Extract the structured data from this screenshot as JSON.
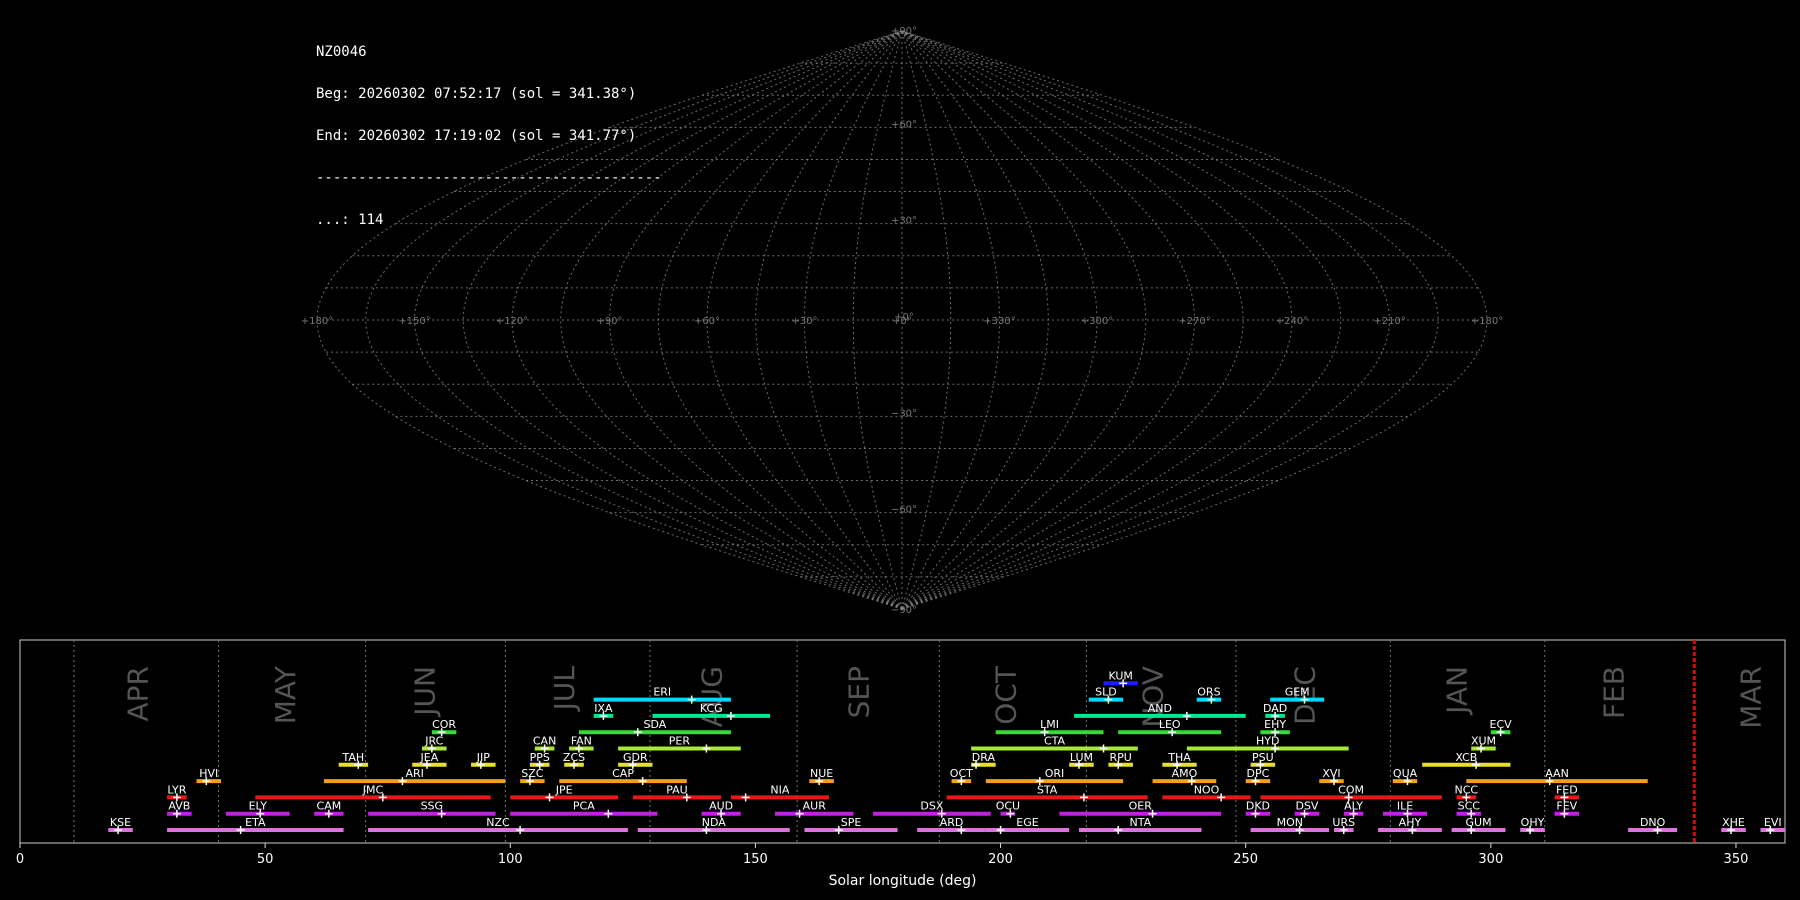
{
  "info": {
    "station": "NZ0046",
    "beg": "Beg: 20260302 07:52:17 (sol = 341.38°)",
    "end": "End: 20260302 17:19:02 (sol = 341.77°)",
    "separator": "-----------------------------------------",
    "count": "...: 114"
  },
  "sky_labels": {
    "lat": [
      "+90°",
      "+60°",
      "+30°",
      "+0°",
      "−30°",
      "−60°",
      "−90°"
    ],
    "lon": [
      "+180°",
      "+150°",
      "+120°",
      "+90°",
      "+60°",
      "+30°",
      "+0°",
      "+330°",
      "+300°",
      "+270°",
      "+240°",
      "+210°",
      "+180°"
    ]
  },
  "chart_data": {
    "type": "timeline",
    "title": "",
    "xlabel": "Solar longitude (deg)",
    "ylabel": "",
    "xlim": [
      0,
      360
    ],
    "xticks": [
      0,
      50,
      100,
      150,
      200,
      250,
      300,
      350
    ],
    "tick_labels": [
      "0",
      "50",
      "100",
      "150",
      "200",
      "250",
      "300",
      "350"
    ],
    "current_sol": 341.5,
    "months": [
      {
        "name": "APR",
        "sol": 11
      },
      {
        "name": "MAY",
        "sol": 40.5
      },
      {
        "name": "JUN",
        "sol": 70.5
      },
      {
        "name": "JUL",
        "sol": 99
      },
      {
        "name": "AUG",
        "sol": 128.5
      },
      {
        "name": "SEP",
        "sol": 158.5
      },
      {
        "name": "OCT",
        "sol": 187.5
      },
      {
        "name": "NOV",
        "sol": 217.5
      },
      {
        "name": "DEC",
        "sol": 248
      },
      {
        "name": "JAN",
        "sol": 279.5
      },
      {
        "name": "FEB",
        "sol": 311
      }
    ],
    "month_labels": [
      {
        "name": "APR",
        "sol": 24
      },
      {
        "name": "MAY",
        "sol": 54
      },
      {
        "name": "JUN",
        "sol": 82.5
      },
      {
        "name": "JUL",
        "sol": 111
      },
      {
        "name": "AUG",
        "sol": 141
      },
      {
        "name": "SEP",
        "sol": 171
      },
      {
        "name": "OCT",
        "sol": 201
      },
      {
        "name": "NOV",
        "sol": 231
      },
      {
        "name": "DEC",
        "sol": 262
      },
      {
        "name": "JAN",
        "sol": 293
      },
      {
        "name": "FEB",
        "sol": 325
      },
      {
        "name": "MAR",
        "sol": 353
      }
    ],
    "showers": [
      {
        "code": "KUM",
        "start": 221,
        "end": 228,
        "peak": 225,
        "row": 9,
        "color": "#1c1cff"
      },
      {
        "code": "ERI",
        "start": 117,
        "end": 145,
        "peak": 137,
        "row": 8,
        "color": "#00d8ff"
      },
      {
        "code": "SLD",
        "start": 218,
        "end": 225,
        "peak": 222,
        "row": 8,
        "color": "#00d8ff"
      },
      {
        "code": "ORS",
        "start": 240,
        "end": 245,
        "peak": 243,
        "row": 8,
        "color": "#00d8ff"
      },
      {
        "code": "GEM",
        "start": 255,
        "end": 266,
        "peak": 262,
        "row": 8,
        "color": "#00d8ff"
      },
      {
        "code": "IXA",
        "start": 117,
        "end": 121,
        "peak": 119,
        "row": 7,
        "color": "#00e890"
      },
      {
        "code": "KCG",
        "start": 129,
        "end": 153,
        "peak": 145,
        "row": 7,
        "color": "#00e890"
      },
      {
        "code": "AND",
        "start": 215,
        "end": 250,
        "peak": 238,
        "row": 7,
        "color": "#00e890"
      },
      {
        "code": "DAD",
        "start": 254,
        "end": 258,
        "peak": 256,
        "row": 7,
        "color": "#00e890"
      },
      {
        "code": "COR",
        "start": 84,
        "end": 89,
        "peak": 86,
        "row": 6,
        "color": "#38d838"
      },
      {
        "code": "SDA",
        "start": 114,
        "end": 145,
        "peak": 126,
        "row": 6,
        "color": "#38d838"
      },
      {
        "code": "LMI",
        "start": 199,
        "end": 221,
        "peak": 209,
        "row": 6,
        "color": "#38d838"
      },
      {
        "code": "LEO",
        "start": 224,
        "end": 245,
        "peak": 235,
        "row": 6,
        "color": "#38d838"
      },
      {
        "code": "EHY",
        "start": 253,
        "end": 259,
        "peak": 256,
        "row": 6,
        "color": "#38d838"
      },
      {
        "code": "ECV",
        "start": 300,
        "end": 304,
        "peak": 302,
        "row": 6,
        "color": "#38d838"
      },
      {
        "code": "JRC",
        "start": 82,
        "end": 87,
        "peak": 84,
        "row": 5,
        "color": "#a8e838"
      },
      {
        "code": "CAN",
        "start": 105,
        "end": 109,
        "peak": 107,
        "row": 5,
        "color": "#a8e838"
      },
      {
        "code": "FAN",
        "start": 112,
        "end": 117,
        "peak": 114,
        "row": 5,
        "color": "#a8e838"
      },
      {
        "code": "PER",
        "start": 122,
        "end": 147,
        "peak": 140,
        "row": 5,
        "color": "#a8e838"
      },
      {
        "code": "CTA",
        "start": 194,
        "end": 228,
        "peak": 221,
        "row": 5,
        "color": "#a8e838"
      },
      {
        "code": "HYD",
        "start": 238,
        "end": 271,
        "peak": 256,
        "row": 5,
        "color": "#a8e838"
      },
      {
        "code": "XUM",
        "start": 296,
        "end": 301,
        "peak": 298,
        "row": 5,
        "color": "#a8e838"
      },
      {
        "code": "TAH",
        "start": 65,
        "end": 71,
        "peak": 69,
        "row": 4,
        "color": "#e8e030"
      },
      {
        "code": "JEA",
        "start": 80,
        "end": 87,
        "peak": 83,
        "row": 4,
        "color": "#e8e030"
      },
      {
        "code": "JIP",
        "start": 92,
        "end": 97,
        "peak": 94,
        "row": 4,
        "color": "#e8e030"
      },
      {
        "code": "PPS",
        "start": 104,
        "end": 108,
        "peak": 106,
        "row": 4,
        "color": "#e8e030"
      },
      {
        "code": "ZCS",
        "start": 111,
        "end": 115,
        "peak": 113,
        "row": 4,
        "color": "#e8e030"
      },
      {
        "code": "GDR",
        "start": 122,
        "end": 129,
        "peak": 125,
        "row": 4,
        "color": "#e8e030"
      },
      {
        "code": "DRA",
        "start": 194,
        "end": 199,
        "peak": 195,
        "row": 4,
        "color": "#e8e030"
      },
      {
        "code": "LUM",
        "start": 214,
        "end": 219,
        "peak": 216,
        "row": 4,
        "color": "#e8e030"
      },
      {
        "code": "RPU",
        "start": 222,
        "end": 227,
        "peak": 224,
        "row": 4,
        "color": "#e8e030"
      },
      {
        "code": "THA",
        "start": 233,
        "end": 240,
        "peak": 236,
        "row": 4,
        "color": "#e8e030"
      },
      {
        "code": "PSU",
        "start": 251,
        "end": 256,
        "peak": 253,
        "row": 4,
        "color": "#e8e030"
      },
      {
        "code": "XCB",
        "start": 286,
        "end": 304,
        "peak": 297,
        "row": 4,
        "color": "#e8e030"
      },
      {
        "code": "HVI",
        "start": 36,
        "end": 41,
        "peak": 38,
        "row": 3,
        "color": "#f0a020"
      },
      {
        "code": "ARI",
        "start": 62,
        "end": 99,
        "peak": 78,
        "row": 3,
        "color": "#f0a020"
      },
      {
        "code": "SZC",
        "start": 102,
        "end": 107,
        "peak": 104,
        "row": 3,
        "color": "#f0a020"
      },
      {
        "code": "CAP",
        "start": 110,
        "end": 136,
        "peak": 127,
        "row": 3,
        "color": "#f0a020"
      },
      {
        "code": "NUE",
        "start": 161,
        "end": 166,
        "peak": 163,
        "row": 3,
        "color": "#f0a020"
      },
      {
        "code": "OCT",
        "start": 190,
        "end": 194,
        "peak": 192,
        "row": 3,
        "color": "#f0a020"
      },
      {
        "code": "ORI",
        "start": 197,
        "end": 225,
        "peak": 208,
        "row": 3,
        "color": "#f0a020"
      },
      {
        "code": "AMO",
        "start": 231,
        "end": 244,
        "peak": 239,
        "row": 3,
        "color": "#f0a020"
      },
      {
        "code": "DPC",
        "start": 250,
        "end": 255,
        "peak": 252,
        "row": 3,
        "color": "#f0a020"
      },
      {
        "code": "XVI",
        "start": 265,
        "end": 270,
        "peak": 268,
        "row": 3,
        "color": "#f0a020"
      },
      {
        "code": "QUA",
        "start": 280,
        "end": 285,
        "peak": 283,
        "row": 3,
        "color": "#f0a020"
      },
      {
        "code": "AAN",
        "start": 295,
        "end": 332,
        "peak": 312,
        "row": 3,
        "color": "#f0a020"
      },
      {
        "code": "LYR",
        "start": 30,
        "end": 34,
        "peak": 32,
        "row": 2,
        "color": "#e81818"
      },
      {
        "code": "JMC",
        "start": 48,
        "end": 96,
        "peak": 74,
        "row": 2,
        "color": "#e81818"
      },
      {
        "code": "JPE",
        "start": 100,
        "end": 122,
        "peak": 108,
        "row": 2,
        "color": "#e81818"
      },
      {
        "code": "PAU",
        "start": 125,
        "end": 143,
        "peak": 136,
        "row": 2,
        "color": "#e81818"
      },
      {
        "code": "NIA",
        "start": 145,
        "end": 165,
        "peak": 148,
        "row": 2,
        "color": "#e81818"
      },
      {
        "code": "STA",
        "start": 189,
        "end": 230,
        "peak": 217,
        "row": 2,
        "color": "#e81818"
      },
      {
        "code": "NOO",
        "start": 233,
        "end": 251,
        "peak": 245,
        "row": 2,
        "color": "#e81818"
      },
      {
        "code": "COM",
        "start": 253,
        "end": 290,
        "peak": 271,
        "row": 2,
        "color": "#e81818"
      },
      {
        "code": "NCC",
        "start": 293,
        "end": 297,
        "peak": 295,
        "row": 2,
        "color": "#e81818"
      },
      {
        "code": "FED",
        "start": 313,
        "end": 318,
        "peak": 315,
        "row": 2,
        "color": "#e81818"
      },
      {
        "code": "AVB",
        "start": 30,
        "end": 35,
        "peak": 32,
        "row": 1,
        "color": "#c020e0"
      },
      {
        "code": "ELY",
        "start": 42,
        "end": 55,
        "peak": 49,
        "row": 1,
        "color": "#c020e0"
      },
      {
        "code": "CAM",
        "start": 60,
        "end": 66,
        "peak": 63,
        "row": 1,
        "color": "#c020e0"
      },
      {
        "code": "SSG",
        "start": 71,
        "end": 97,
        "peak": 86,
        "row": 1,
        "color": "#c020e0"
      },
      {
        "code": "PCA",
        "start": 100,
        "end": 130,
        "peak": 120,
        "row": 1,
        "color": "#c020e0"
      },
      {
        "code": "AUD",
        "start": 139,
        "end": 147,
        "peak": 143,
        "row": 1,
        "color": "#c020e0"
      },
      {
        "code": "AUR",
        "start": 154,
        "end": 170,
        "peak": 159,
        "row": 1,
        "color": "#c020e0"
      },
      {
        "code": "DSX",
        "start": 174,
        "end": 198,
        "peak": 188,
        "row": 1,
        "color": "#c020e0"
      },
      {
        "code": "OCU",
        "start": 200,
        "end": 203,
        "peak": 202,
        "row": 1,
        "color": "#c020e0"
      },
      {
        "code": "OER",
        "start": 212,
        "end": 245,
        "peak": 231,
        "row": 1,
        "color": "#c020e0"
      },
      {
        "code": "DKD",
        "start": 250,
        "end": 255,
        "peak": 252,
        "row": 1,
        "color": "#c020e0"
      },
      {
        "code": "DSV",
        "start": 260,
        "end": 265,
        "peak": 262,
        "row": 1,
        "color": "#c020e0"
      },
      {
        "code": "ALY",
        "start": 270,
        "end": 274,
        "peak": 272,
        "row": 1,
        "color": "#c020e0"
      },
      {
        "code": "ILE",
        "start": 278,
        "end": 287,
        "peak": 283,
        "row": 1,
        "color": "#c020e0"
      },
      {
        "code": "SCC",
        "start": 293,
        "end": 298,
        "peak": 296,
        "row": 1,
        "color": "#c020e0"
      },
      {
        "code": "FEV",
        "start": 313,
        "end": 318,
        "peak": 315,
        "row": 1,
        "color": "#c020e0"
      },
      {
        "code": "KSE",
        "start": 18,
        "end": 23,
        "peak": 20,
        "row": 0,
        "color": "#e070e0"
      },
      {
        "code": "ETA",
        "start": 30,
        "end": 66,
        "peak": 45,
        "row": 0,
        "color": "#e070e0"
      },
      {
        "code": "NZC",
        "start": 71,
        "end": 124,
        "peak": 102,
        "row": 0,
        "color": "#e070e0"
      },
      {
        "code": "NDA",
        "start": 126,
        "end": 157,
        "peak": 140,
        "row": 0,
        "color": "#e070e0"
      },
      {
        "code": "SPE",
        "start": 160,
        "end": 179,
        "peak": 167,
        "row": 0,
        "color": "#e070e0"
      },
      {
        "code": "ARD",
        "start": 183,
        "end": 197,
        "peak": 192,
        "row": 0,
        "color": "#e070e0"
      },
      {
        "code": "EGE",
        "start": 197,
        "end": 214,
        "peak": 200,
        "row": 0,
        "color": "#e070e0"
      },
      {
        "code": "NTA",
        "start": 216,
        "end": 241,
        "peak": 224,
        "row": 0,
        "color": "#e070e0"
      },
      {
        "code": "MON",
        "start": 251,
        "end": 267,
        "peak": 261,
        "row": 0,
        "color": "#e070e0"
      },
      {
        "code": "URS",
        "start": 268,
        "end": 272,
        "peak": 270,
        "row": 0,
        "color": "#e070e0"
      },
      {
        "code": "AHY",
        "start": 277,
        "end": 290,
        "peak": 284,
        "row": 0,
        "color": "#e070e0"
      },
      {
        "code": "GUM",
        "start": 292,
        "end": 303,
        "peak": 296,
        "row": 0,
        "color": "#e070e0"
      },
      {
        "code": "OHY",
        "start": 306,
        "end": 311,
        "peak": 308,
        "row": 0,
        "color": "#e070e0"
      },
      {
        "code": "DNO",
        "start": 328,
        "end": 338,
        "peak": 334,
        "row": 0,
        "color": "#e070e0"
      },
      {
        "code": "XHE",
        "start": 347,
        "end": 352,
        "peak": 349,
        "row": 0,
        "color": "#e070e0"
      },
      {
        "code": "EVI",
        "start": 355,
        "end": 360,
        "peak": 357,
        "row": 0,
        "color": "#e070e0"
      }
    ]
  },
  "colors": {
    "background": "#000000",
    "grid": "#888888",
    "frame": "#cccccc",
    "current_marker": "#d01010",
    "month_text": "#555555"
  }
}
